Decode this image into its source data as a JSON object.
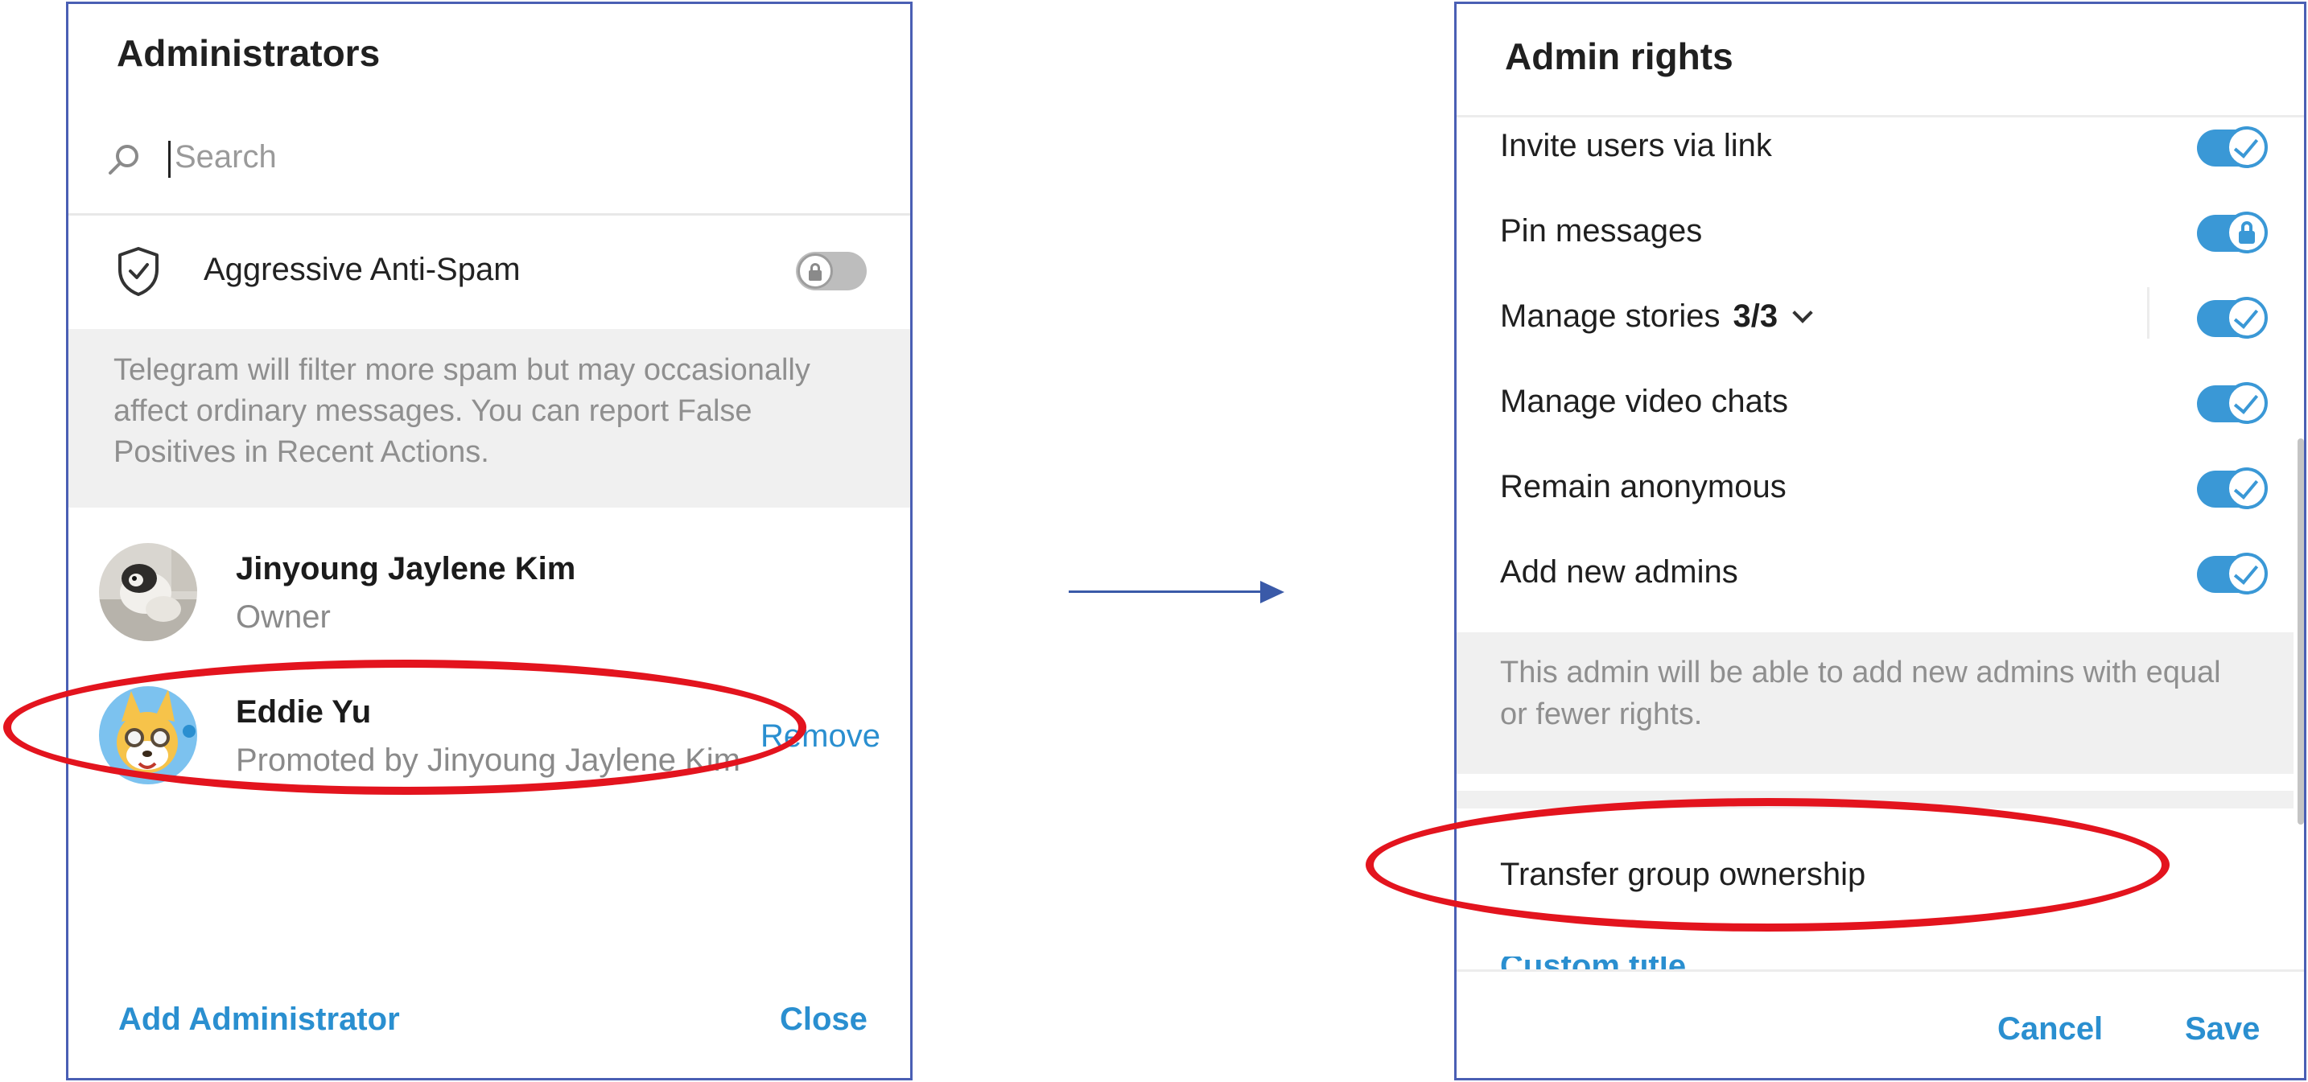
{
  "left_panel": {
    "title": "Administrators",
    "search": {
      "placeholder": "Search",
      "icon": "search-icon"
    },
    "antispam": {
      "label": "Aggressive Anti-Spam",
      "enabled": false,
      "locked": true,
      "description": "Telegram will filter more spam but may occasionally affect ordinary messages. You can report False Positives in Recent Actions."
    },
    "members": [
      {
        "name": "Jinyoung Jaylene Kim",
        "role": "Owner",
        "action": ""
      },
      {
        "name": "Eddie Yu",
        "role": "Promoted by Jinyoung Jaylene Kim",
        "action": "Remove"
      }
    ],
    "footer": {
      "add_label": "Add Administrator",
      "close_label": "Close"
    }
  },
  "right_panel": {
    "title": "Admin rights",
    "permissions": [
      {
        "label": "Invite users via link",
        "enabled": true,
        "locked": false
      },
      {
        "label": "Pin messages",
        "enabled": true,
        "locked": true
      },
      {
        "label": "Manage stories",
        "count": "3/3",
        "enabled": true,
        "locked": false
      },
      {
        "label": "Manage video chats",
        "enabled": true,
        "locked": false
      },
      {
        "label": "Remain anonymous",
        "enabled": true,
        "locked": false
      },
      {
        "label": "Add new admins",
        "enabled": true,
        "locked": false
      }
    ],
    "note": "This admin will be able to add new admins with equal or fewer rights.",
    "transfer_label": "Transfer group ownership",
    "custom_title_label": "Custom title",
    "footer": {
      "cancel_label": "Cancel",
      "save_label": "Save"
    }
  },
  "colors": {
    "accent": "#2a8fd0",
    "toggle_on": "#3a98d6",
    "annotation": "#e3141e",
    "panel_border": "#4a5fb4"
  }
}
